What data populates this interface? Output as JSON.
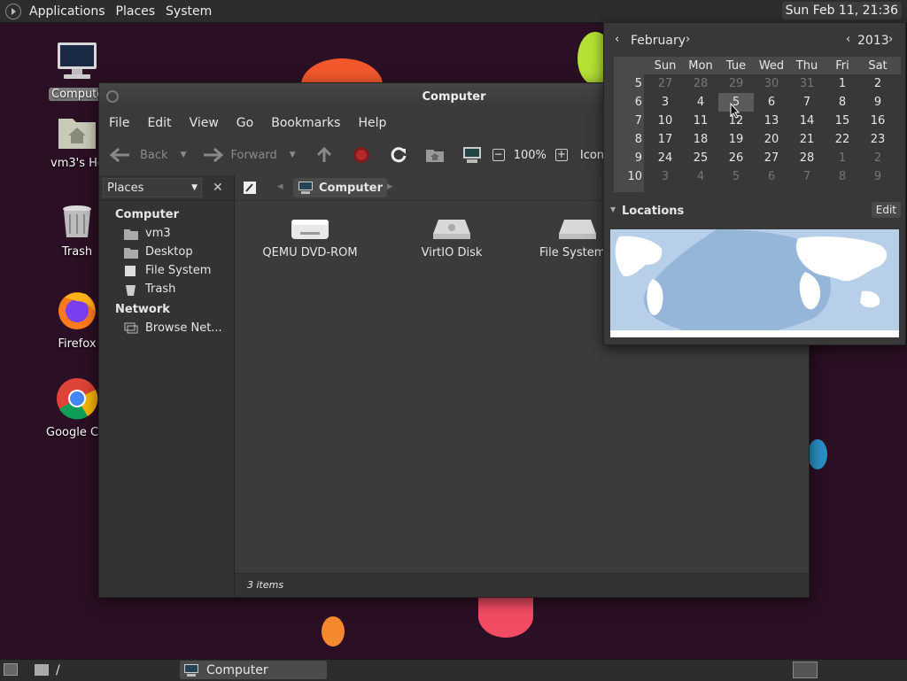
{
  "top_panel": {
    "menus": [
      "Applications",
      "Places",
      "System"
    ],
    "clock": "Sun Feb 11, 21:36"
  },
  "desktop": {
    "icons": [
      {
        "label": "Computer"
      },
      {
        "label": "vm3's Home"
      },
      {
        "label": "Trash"
      },
      {
        "label": "Firefox"
      },
      {
        "label": "Google Chrome"
      }
    ]
  },
  "file_manager": {
    "title": "Computer",
    "menus": [
      "File",
      "Edit",
      "View",
      "Go",
      "Bookmarks",
      "Help"
    ],
    "toolbar": {
      "back": "Back",
      "forward": "Forward",
      "zoom": "100%",
      "view_mode": "Icon View"
    },
    "sidebar": {
      "selector": "Places",
      "sections": [
        {
          "heading": "Computer",
          "items": [
            "vm3",
            "Desktop",
            "File System",
            "Trash"
          ]
        },
        {
          "heading": "Network",
          "items": [
            "Browse Net..."
          ]
        }
      ]
    },
    "path": "Computer",
    "items": [
      "QEMU DVD-ROM",
      "VirtIO Disk",
      "File System"
    ],
    "status": "3 items"
  },
  "calendar": {
    "month": "February",
    "year": "2013",
    "weekdays": [
      "Sun",
      "Mon",
      "Tue",
      "Wed",
      "Thu",
      "Fri",
      "Sat"
    ],
    "weeks": [
      {
        "num": "5",
        "days": [
          "27",
          "28",
          "29",
          "30",
          "31",
          "1",
          "2"
        ]
      },
      {
        "num": "6",
        "days": [
          "3",
          "4",
          "5",
          "6",
          "7",
          "8",
          "9"
        ]
      },
      {
        "num": "7",
        "days": [
          "10",
          "11",
          "12",
          "13",
          "14",
          "15",
          "16"
        ]
      },
      {
        "num": "8",
        "days": [
          "17",
          "18",
          "19",
          "20",
          "21",
          "22",
          "23"
        ]
      },
      {
        "num": "9",
        "days": [
          "24",
          "25",
          "26",
          "27",
          "28",
          "1",
          "2"
        ]
      },
      {
        "num": "10",
        "days": [
          "3",
          "4",
          "5",
          "6",
          "7",
          "8",
          "9"
        ]
      }
    ],
    "selected_day": "5",
    "locations_label": "Locations",
    "edit_label": "Edit"
  },
  "bottom_panel": {
    "path": "/",
    "task": "Computer"
  }
}
